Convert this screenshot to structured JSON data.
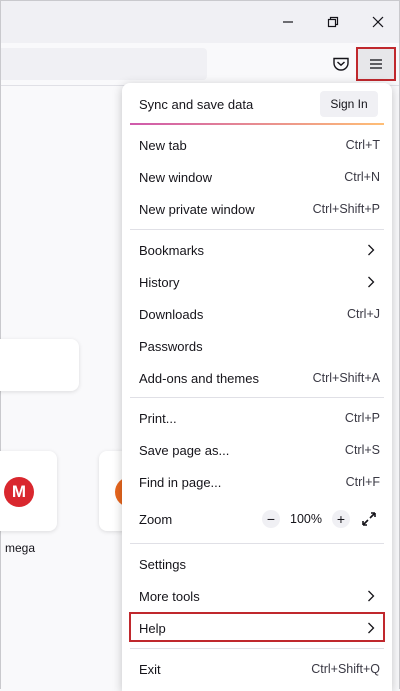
{
  "window": {
    "minimize_icon": "minimize-icon",
    "restore_icon": "restore-icon",
    "close_icon": "close-icon"
  },
  "toolbar": {
    "pocket_icon": "pocket-icon",
    "menu_icon": "hamburger-menu-icon"
  },
  "newtab": {
    "tiles": [
      {
        "label": "mega",
        "logo_letter": "M",
        "color": "#d9272e"
      },
      {
        "label": "",
        "color": "#e8661e"
      }
    ]
  },
  "menu": {
    "sync_label": "Sync and save data",
    "signin_label": "Sign In",
    "items": [
      {
        "label": "New tab",
        "shortcut": "Ctrl+T"
      },
      {
        "label": "New window",
        "shortcut": "Ctrl+N"
      },
      {
        "label": "New private window",
        "shortcut": "Ctrl+Shift+P"
      },
      {
        "label": "Bookmarks",
        "shortcut": ""
      },
      {
        "label": "History",
        "shortcut": ""
      },
      {
        "label": "Downloads",
        "shortcut": "Ctrl+J"
      },
      {
        "label": "Passwords",
        "shortcut": ""
      },
      {
        "label": "Add-ons and themes",
        "shortcut": "Ctrl+Shift+A"
      },
      {
        "label": "Print...",
        "shortcut": "Ctrl+P"
      },
      {
        "label": "Save page as...",
        "shortcut": "Ctrl+S"
      },
      {
        "label": "Find in page...",
        "shortcut": "Ctrl+F"
      },
      {
        "label": "Zoom",
        "shortcut": ""
      },
      {
        "label": "Settings",
        "shortcut": ""
      },
      {
        "label": "More tools",
        "shortcut": ""
      },
      {
        "label": "Help",
        "shortcut": ""
      },
      {
        "label": "Exit",
        "shortcut": "Ctrl+Shift+Q"
      }
    ],
    "zoom": {
      "minus": "−",
      "value": "100%",
      "plus": "+"
    },
    "highlight_color": "#c0282d"
  }
}
